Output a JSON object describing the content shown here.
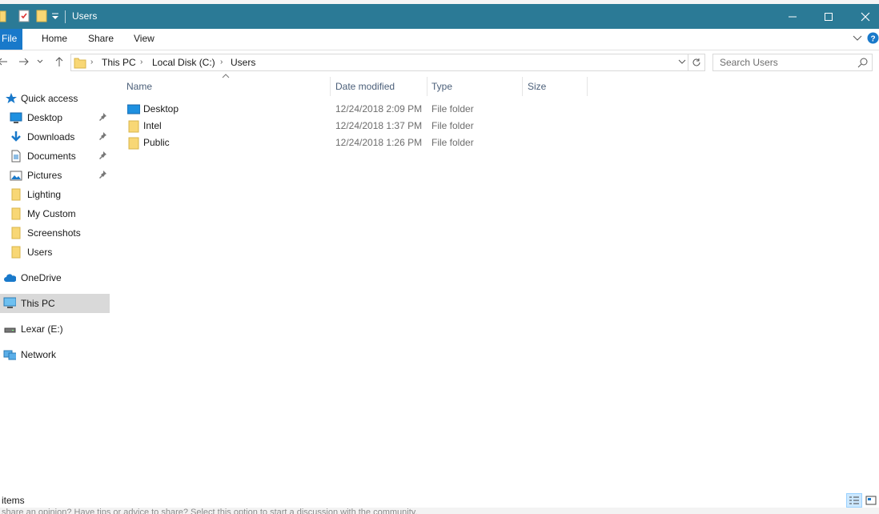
{
  "window": {
    "title": "Users"
  },
  "background": {
    "bottom_text": "share an opinion? Have tips or advice to share? Select this option to start a discussion with the community."
  },
  "ribbon": {
    "tabs": [
      {
        "label": "File"
      },
      {
        "label": "Home"
      },
      {
        "label": "Share"
      },
      {
        "label": "View"
      }
    ]
  },
  "address": {
    "crumbs": [
      "This PC",
      "Local Disk (C:)",
      "Users"
    ]
  },
  "search": {
    "placeholder": "Search Users"
  },
  "nav": {
    "quick_access": "Quick access",
    "pinned": [
      "Desktop",
      "Downloads",
      "Documents",
      "Pictures"
    ],
    "folders": [
      "Lighting",
      "My Custom",
      "Screenshots",
      "Users"
    ],
    "onedrive": "OneDrive",
    "this_pc": "This PC",
    "lexar": "Lexar (E:)",
    "network": "Network"
  },
  "columns": {
    "name": "Name",
    "date": "Date modified",
    "type": "Type",
    "size": "Size"
  },
  "files": [
    {
      "name": "Desktop",
      "date": "12/24/2018 2:09 PM",
      "type": "File folder",
      "icon": "desktop-folder-icon"
    },
    {
      "name": "Intel",
      "date": "12/24/2018 1:37 PM",
      "type": "File folder",
      "icon": "folder-icon"
    },
    {
      "name": "Public",
      "date": "12/24/2018 1:26 PM",
      "type": "File folder",
      "icon": "folder-icon"
    }
  ],
  "status": {
    "item_count": "items"
  },
  "colors": {
    "titlebar": "#2b7a96",
    "file_tab": "#1979ca",
    "selected": "#d9d9d9",
    "folder": "#f8d775"
  }
}
